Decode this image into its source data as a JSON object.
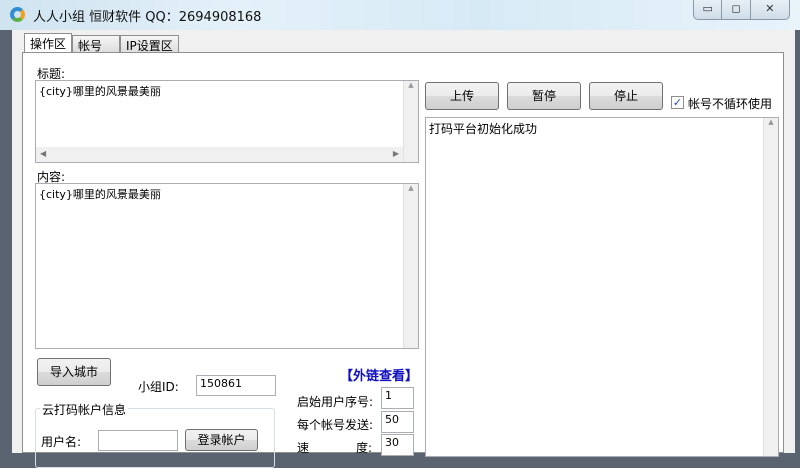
{
  "window": {
    "title": "人人小组  恒财软件 QQ：2694908168",
    "controls": [
      "▭",
      "◻",
      "✕"
    ]
  },
  "tabs": [
    {
      "label": "操作区"
    },
    {
      "label": "帐号"
    },
    {
      "label": "IP设置区"
    }
  ],
  "form": {
    "title_label": "标题:",
    "title_value": "{city}哪里的风景最美丽",
    "content_label": "内容:",
    "content_value": "{city}哪里的风景最美丽",
    "import_city_button": "导入城市",
    "group_id_label": "小组ID:",
    "group_id_value": "150861",
    "external_link": "【外链查看】",
    "cloud_group_label": "云打码帐户信息",
    "username_label": "用户名:",
    "username_value": "",
    "login_button": "登录帐户",
    "start_index_label": "启始用户序号:",
    "start_index_value": "1",
    "per_account_label": "每个帐号发送:",
    "per_account_value": "50",
    "speed_label_a": "速",
    "speed_label_b": "度:",
    "speed_value": "30"
  },
  "actions": {
    "upload": "上传",
    "pause": "暂停",
    "stop": "停止",
    "no_loop_label": "帐号不循环使用",
    "no_loop_checked": true
  },
  "log": {
    "text": "打码平台初始化成功"
  },
  "colors": {
    "link": "#1010c0"
  }
}
